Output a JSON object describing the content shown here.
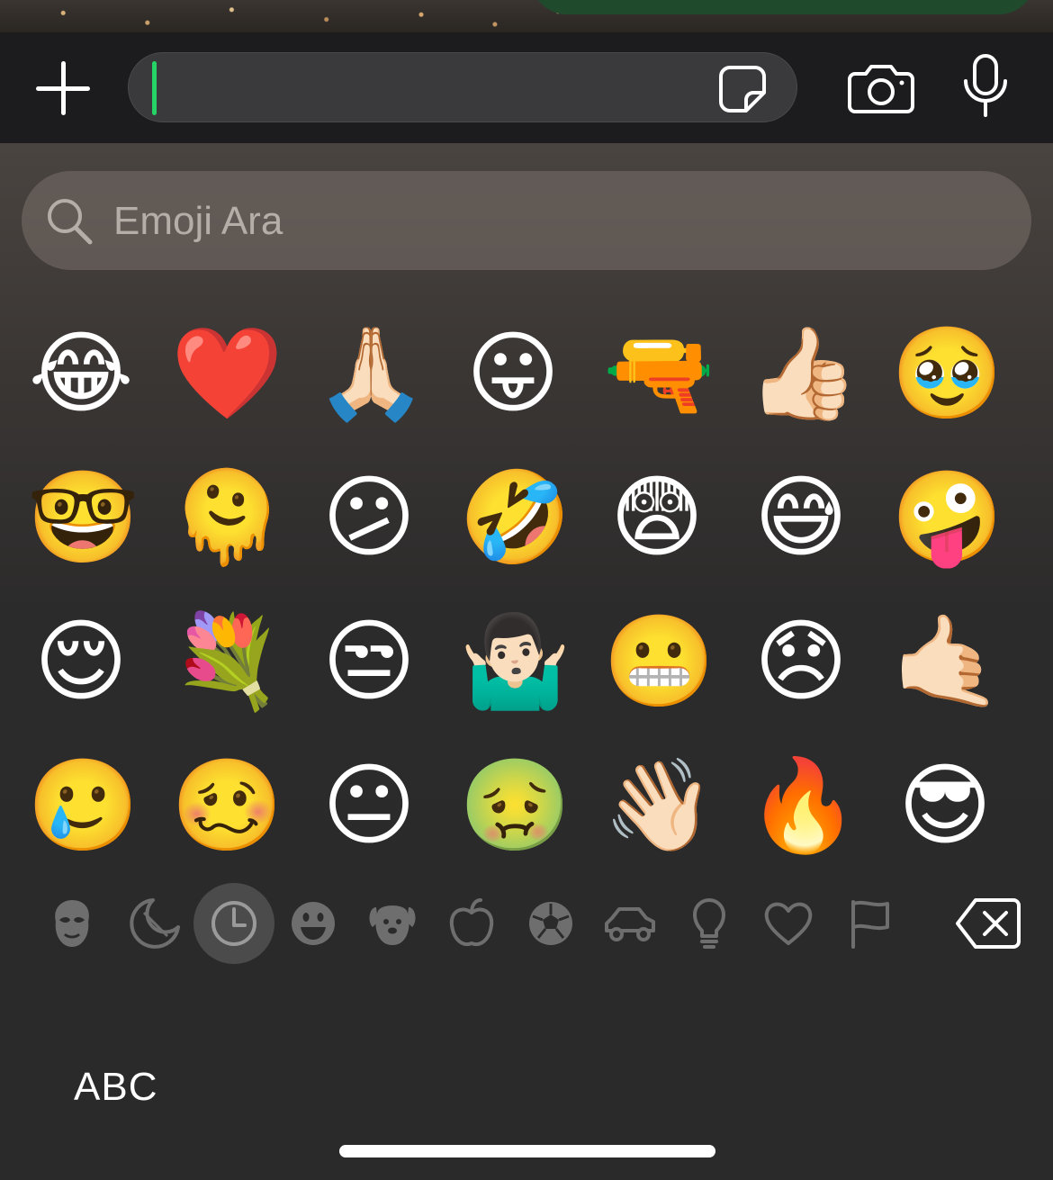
{
  "composer": {
    "add_label": "+",
    "text_value": ""
  },
  "search": {
    "placeholder": "Emoji Ara"
  },
  "emoji_grid": {
    "row1": [
      "😂",
      "❤️",
      "🙏🏻",
      "😛",
      "🔫",
      "👍🏻",
      "🥹"
    ],
    "row2": [
      "🤓",
      "🫠",
      "😕",
      "🤣",
      "😨",
      "😅",
      "🤪"
    ],
    "row3": [
      "😌",
      "💐",
      "😒",
      "🤷🏻‍♂️",
      "😬",
      "😞",
      "🤙🏻"
    ],
    "row4": [
      "🥲",
      "🥴",
      "😐",
      "🤢",
      "👋🏻",
      "🔥",
      "😎"
    ]
  },
  "categories": [
    {
      "name": "memoji",
      "icon": "memoji-icon"
    },
    {
      "name": "stickers",
      "icon": "sticker-moon-icon"
    },
    {
      "name": "recent",
      "icon": "clock-icon",
      "active": true
    },
    {
      "name": "smileys",
      "icon": "smiley-icon"
    },
    {
      "name": "animals",
      "icon": "dog-icon"
    },
    {
      "name": "food",
      "icon": "apple-icon"
    },
    {
      "name": "activity",
      "icon": "soccer-ball-icon"
    },
    {
      "name": "travel",
      "icon": "car-icon"
    },
    {
      "name": "objects",
      "icon": "lightbulb-icon"
    },
    {
      "name": "symbols",
      "icon": "heart-icon"
    },
    {
      "name": "flags",
      "icon": "flag-icon"
    }
  ],
  "keyboard": {
    "abc_label": "ABC"
  },
  "colors": {
    "caret": "#25d366",
    "icon_gray": "#6e6e6e"
  }
}
